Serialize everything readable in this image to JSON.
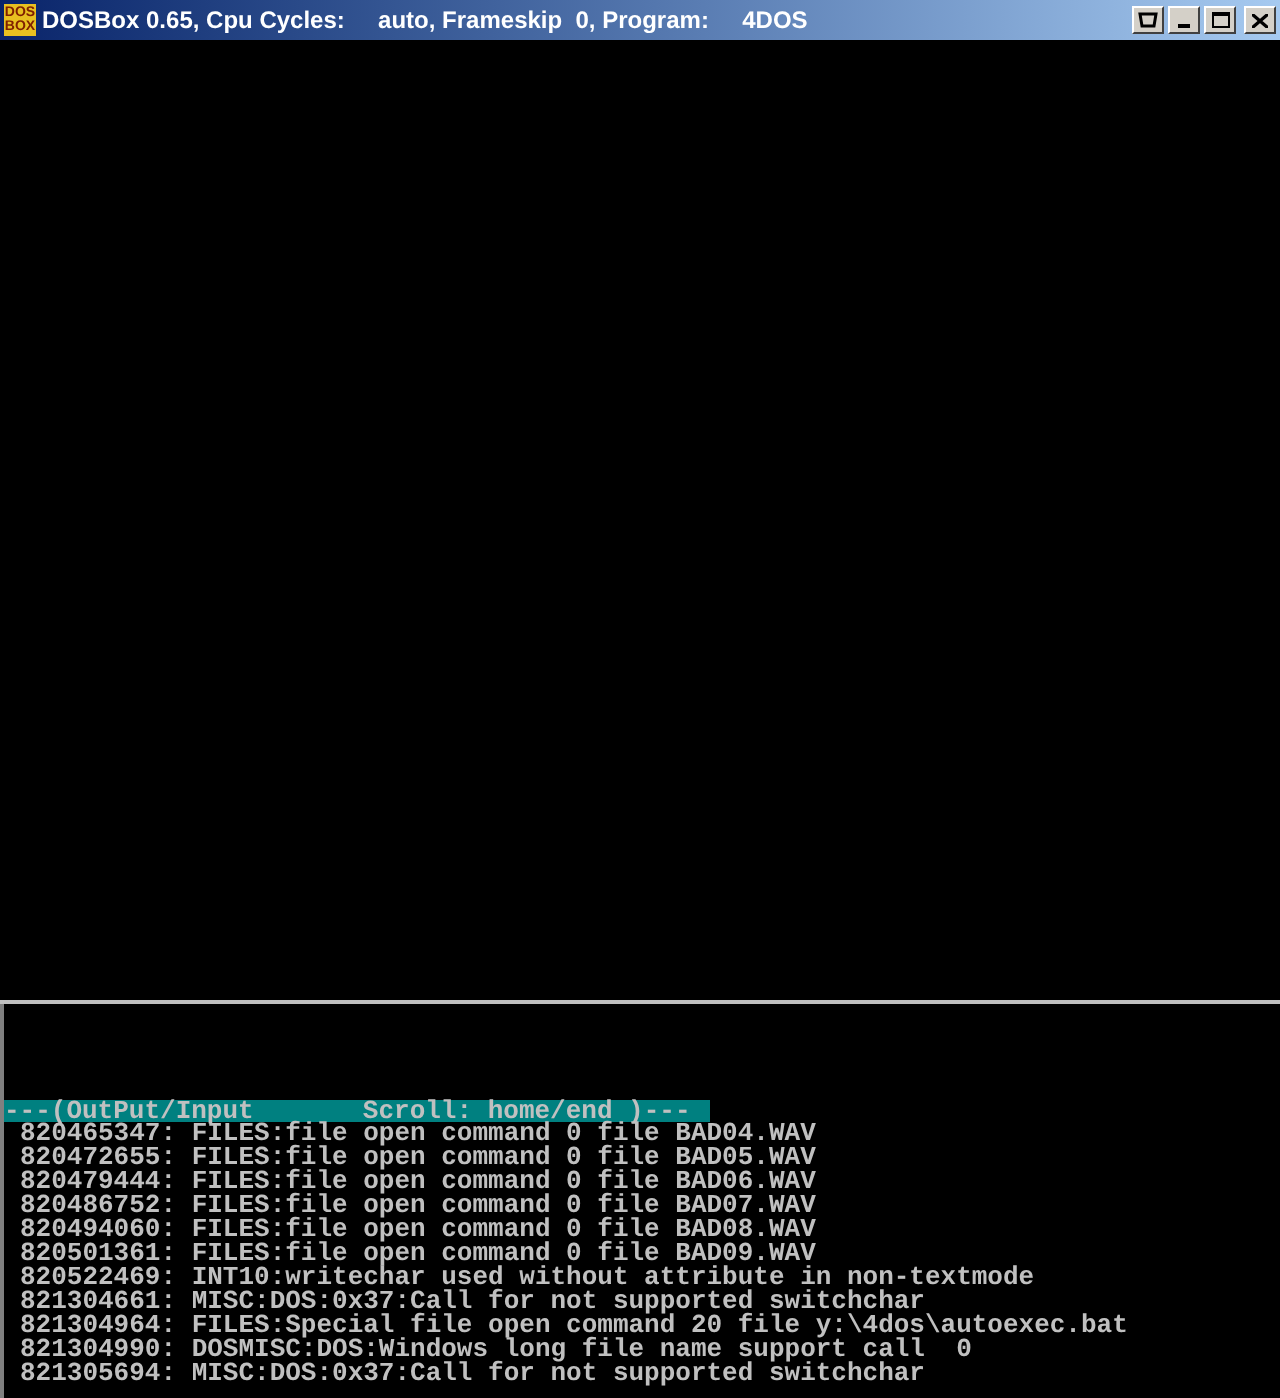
{
  "window": {
    "title": "DOSBox 0.65, Cpu Cycles:     auto, Frameskip  0, Program:     4DOS",
    "icon_text": [
      "DOS",
      "BOX"
    ]
  },
  "console": {
    "header": "---(OutPut/Input       Scroll: home/end )---",
    "lines": [
      "820465347: FILES:file open command 0 file BAD04.WAV",
      "820472655: FILES:file open command 0 file BAD05.WAV",
      "820479444: FILES:file open command 0 file BAD06.WAV",
      "820486752: FILES:file open command 0 file BAD07.WAV",
      "820494060: FILES:file open command 0 file BAD08.WAV",
      "820501361: FILES:file open command 0 file BAD09.WAV",
      "820522469: INT10:writechar used without attribute in non-textmode",
      "821304661: MISC:DOS:0x37:Call for not supported switchchar",
      "821304964: FILES:Special file open command 20 file y:\\4dos\\autoexec.bat",
      "821304990: DOSMISC:DOS:Windows long file name support call  0",
      "821305694: MISC:DOS:0x37:Call for not supported switchchar"
    ]
  }
}
